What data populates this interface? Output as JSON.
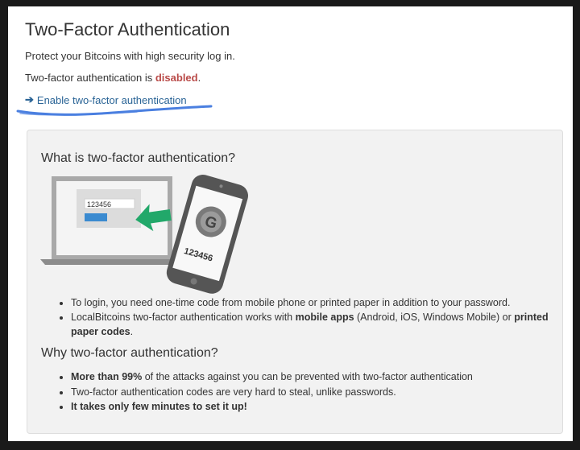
{
  "page": {
    "title": "Two-Factor Authentication",
    "subtitle": "Protect your Bitcoins with high security log in.",
    "status_prefix": "Two-factor authentication is ",
    "status_value": "disabled",
    "status_suffix": ".",
    "enable_link": "Enable two-factor authentication"
  },
  "info": {
    "heading1": "What is two-factor authentication?",
    "illustration": {
      "laptop_code": "123456",
      "phone_code": "123456",
      "phone_logo": "G"
    },
    "bullets1": [
      {
        "pre": "To login, you need one-time code from mobile phone or printed paper in addition to your password.",
        "bold1": "",
        "mid": "",
        "bold2": "",
        "post": ""
      },
      {
        "pre": "LocalBitcoins two-factor authentication works with ",
        "bold1": "mobile apps",
        "mid": " (Android, iOS, Windows Mobile) or ",
        "bold2": "printed paper codes",
        "post": "."
      }
    ],
    "heading2": "Why two-factor authentication?",
    "bullets2": [
      {
        "bold": "More than 99%",
        "text": " of the attacks against you can be prevented with two-factor authentication"
      },
      {
        "bold": "",
        "text": "Two-factor authentication codes are very hard to steal, unlike passwords."
      },
      {
        "bold": "It takes only few minutes to set it up!",
        "text": ""
      }
    ]
  },
  "colors": {
    "disabled": "#b94a48",
    "link": "#2a6496",
    "annotation_scribble": "#4a7fe0",
    "arrow_green": "#22a86a"
  }
}
